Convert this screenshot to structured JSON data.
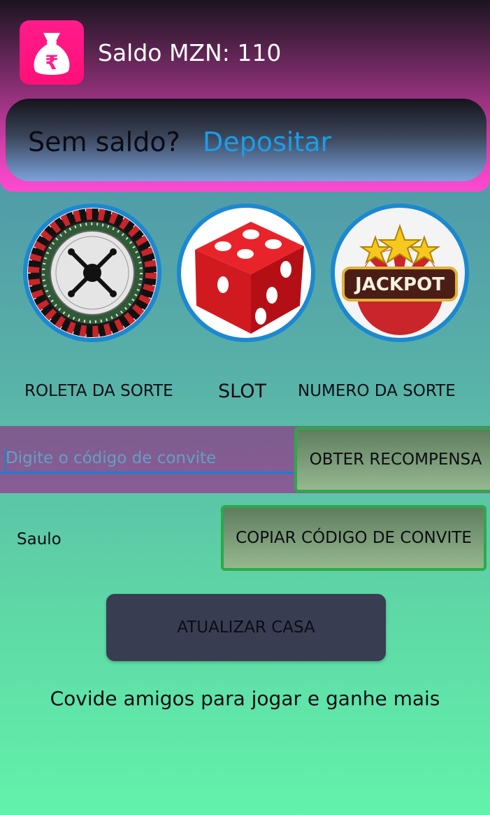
{
  "header": {
    "app_icon": "money-bag-rupee-icon",
    "balance_text": "Saldo MZN: 110",
    "deposit_prompt": "Sem saldo?",
    "deposit_link": "Depositar"
  },
  "games": [
    {
      "icon": "roulette-wheel-icon",
      "label": "ROLETA DA SORTE"
    },
    {
      "icon": "red-dice-icon",
      "label": "SLOT"
    },
    {
      "icon": "jackpot-icon",
      "label": "NUMERO DA SORTE"
    }
  ],
  "jackpot_text": "JACKPOT",
  "invite": {
    "placeholder": "Digite o código de convite",
    "value": "",
    "redeem_label": "OBTER RECOMPENSA"
  },
  "user": {
    "name": "Saulo",
    "copy_label": "COPIAR CÓDIGO DE CONVITE"
  },
  "upgrade_label": "ATUALIZAR CASA",
  "footer_text": "Covide amigos para jogar e ganhe mais",
  "colors": {
    "header_top": "#1c1420",
    "header_bottom": "#ff4ad1",
    "link_blue": "#1a9ee8",
    "button_border_green": "#2ea84a",
    "upgrade_button": "#383d52",
    "accent_blue": "#1b88d1"
  }
}
